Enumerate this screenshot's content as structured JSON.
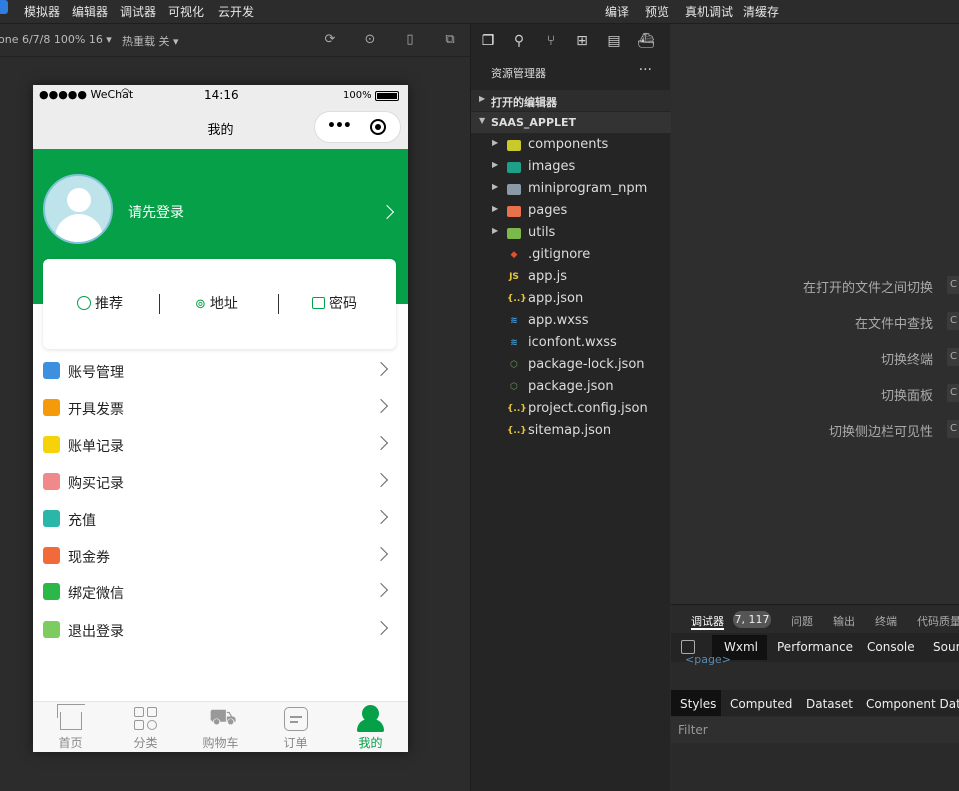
{
  "topbar": {
    "menus": [
      "模拟器",
      "编辑器",
      "调试器",
      "可视化",
      "云开发"
    ],
    "actions": [
      "编译",
      "预览",
      "真机调试",
      "清缓存"
    ]
  },
  "sim_toolbar": {
    "device": "one 6/7/8 100% 16 ▾",
    "hot_reload": "热重载 关 ▾"
  },
  "phone": {
    "status": {
      "carrier": "●●●●● WeChat",
      "time": "14:16",
      "battery": "100%"
    },
    "nav_title": "我的",
    "capsule_dots": "•••",
    "login_text": "请先登录",
    "card_items": [
      {
        "label": "推荐",
        "icon": "clock-icon"
      },
      {
        "label": "地址",
        "icon": "location-icon"
      },
      {
        "label": "密码",
        "icon": "lock-icon"
      }
    ],
    "menu_items": [
      {
        "label": "账号管理",
        "icon": "users-icon",
        "color": "#3d8fe0"
      },
      {
        "label": "开具发票",
        "icon": "yen-icon",
        "color": "#f59b0a"
      },
      {
        "label": "账单记录",
        "icon": "bill-icon",
        "color": "#f5d20a"
      },
      {
        "label": "购买记录",
        "icon": "shopping-bag-icon",
        "color": "#f08a8a"
      },
      {
        "label": "充值",
        "icon": "wallet-icon",
        "color": "#2ab7a9"
      },
      {
        "label": "现金券",
        "icon": "coupon-icon",
        "color": "#f26a3c"
      },
      {
        "label": "绑定微信",
        "icon": "wechat-icon",
        "color": "#2bb74a"
      },
      {
        "label": "退出登录",
        "icon": "logout-icon",
        "color": "#7dcc5f"
      }
    ],
    "tabs": [
      {
        "label": "首页",
        "icon": "home-icon"
      },
      {
        "label": "分类",
        "icon": "grid-icon"
      },
      {
        "label": "购物车",
        "icon": "cart-icon"
      },
      {
        "label": "订单",
        "icon": "order-icon"
      },
      {
        "label": "我的",
        "icon": "person-icon"
      }
    ],
    "active_color": "#05a047"
  },
  "explorer": {
    "title": "资源管理器",
    "dots": "···",
    "open_editors": "打开的编辑器",
    "project": "SAAS_APPLET",
    "files": [
      {
        "name": "components",
        "type": "folder",
        "badge": "",
        "color": "#c9c92a"
      },
      {
        "name": "images",
        "type": "folder",
        "badge": "",
        "color": "#1e9f88"
      },
      {
        "name": "miniprogram_npm",
        "type": "folder",
        "badge": "",
        "color": "#8a9aa6"
      },
      {
        "name": "pages",
        "type": "folder",
        "badge": "",
        "color": "#e8734a"
      },
      {
        "name": "utils",
        "type": "folder",
        "badge": "",
        "color": "#7bb94a"
      },
      {
        "name": ".gitignore",
        "type": "file",
        "badge": "◆",
        "color": "#e4502c"
      },
      {
        "name": "app.js",
        "type": "file",
        "badge": "JS",
        "color": "#e8c63a"
      },
      {
        "name": "app.json",
        "type": "file",
        "badge": "{..}",
        "color": "#e8c63a"
      },
      {
        "name": "app.wxss",
        "type": "file",
        "badge": "≋",
        "color": "#3e9be0"
      },
      {
        "name": "iconfont.wxss",
        "type": "file",
        "badge": "≋",
        "color": "#3e9be0"
      },
      {
        "name": "package-lock.json",
        "type": "file",
        "badge": "⬡",
        "color": "#6a9f4a"
      },
      {
        "name": "package.json",
        "type": "file",
        "badge": "⬡",
        "color": "#6a9f4a"
      },
      {
        "name": "project.config.json",
        "type": "file",
        "badge": "{..}",
        "color": "#e8c63a"
      },
      {
        "name": "sitemap.json",
        "type": "file",
        "badge": "{..}",
        "color": "#e8c63a"
      }
    ]
  },
  "editor_hints": [
    {
      "label": "在打开的文件之间切换",
      "key": "C"
    },
    {
      "label": "在文件中查找",
      "key": "C"
    },
    {
      "label": "切换终端",
      "key": "C"
    },
    {
      "label": "切换面板",
      "key": "C"
    },
    {
      "label": "切换侧边栏可见性",
      "key": "C"
    }
  ],
  "debugger": {
    "tabs": [
      "调试器",
      "问题",
      "输出",
      "终端",
      "代码质量"
    ],
    "badge": "7, 117",
    "subtabs": [
      "Wxml",
      "Performance",
      "Console",
      "Sour"
    ],
    "page_tag": "<page>",
    "style_tabs": [
      "Styles",
      "Computed",
      "Dataset",
      "Component Data"
    ],
    "filter": "Filter"
  }
}
